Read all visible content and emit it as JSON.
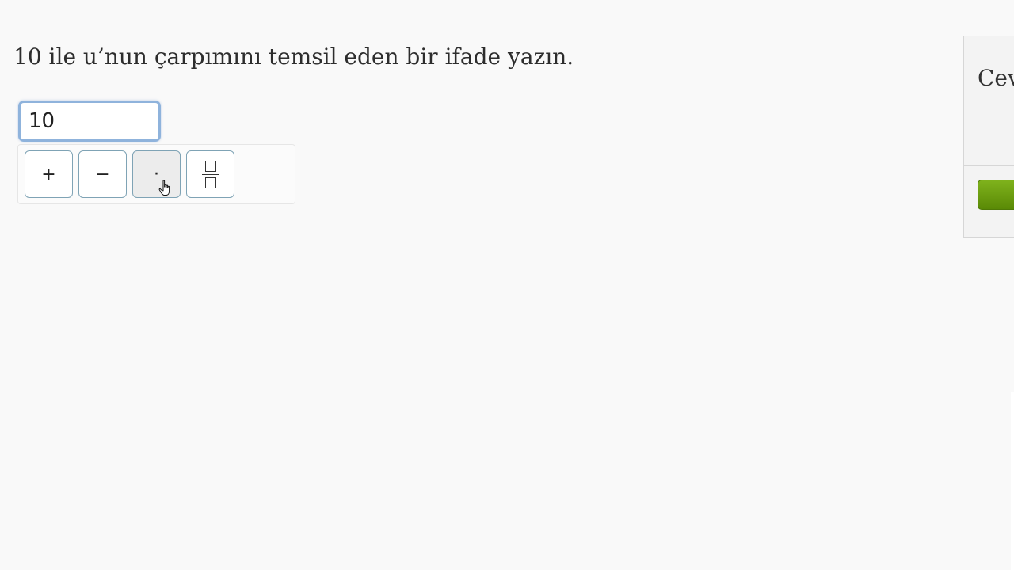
{
  "question": {
    "text": "10 ile u’nun çarpımını temsil eden bir ifade yazın."
  },
  "answer": {
    "value": "10"
  },
  "keypad": {
    "plus_label": "+",
    "minus_label": "−",
    "times_label": "·",
    "fraction_icon": "fraction-icon"
  },
  "side_panel": {
    "title": "Cev"
  },
  "colors": {
    "check_button": "#6a9c10",
    "input_focus_border": "#8fb3dc",
    "key_border": "#7fa3b5"
  }
}
